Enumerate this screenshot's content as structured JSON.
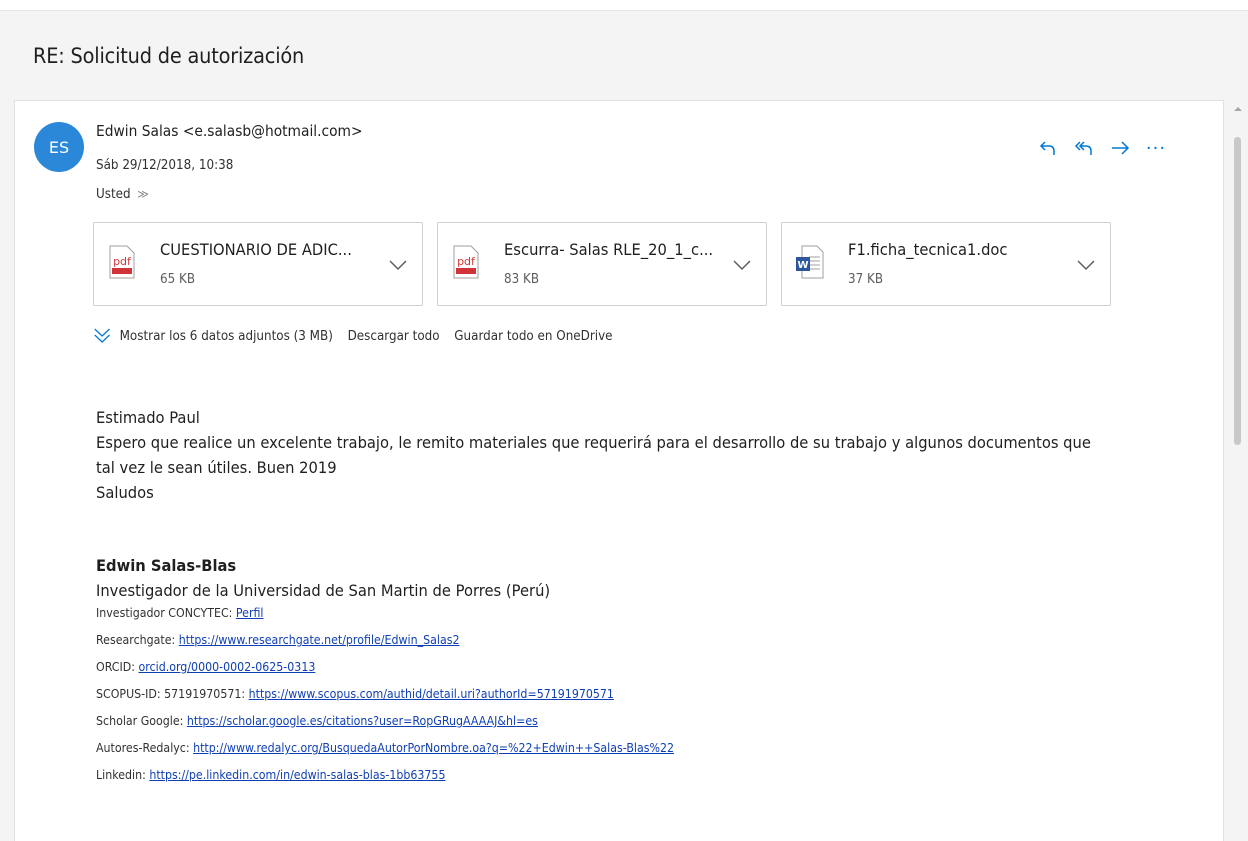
{
  "subject": "RE: Solicitud de autorización",
  "colors": {
    "accent": "#0078d4",
    "avatar_bg": "#2b88d8",
    "pdf_red": "#d13438",
    "word_blue": "#2b579a",
    "link": "#0f3fb4"
  },
  "message": {
    "avatar_initials": "ES",
    "sender": "Edwin Salas <e.salasb@hotmail.com>",
    "date": "Sáb 29/12/2018, 10:38",
    "recipient": "Usted",
    "recipient_chevron": "≫"
  },
  "actions": {
    "reply_icon": "reply-icon",
    "reply_all_icon": "reply-all-icon",
    "forward_icon": "forward-icon",
    "more": "···"
  },
  "attachments": [
    {
      "name": "CUESTIONARIO DE ADIC...",
      "size": "65 KB",
      "icon": "pdf-icon"
    },
    {
      "name": "Escurra- Salas RLE_20_1_c...",
      "size": "83 KB",
      "icon": "pdf-icon"
    },
    {
      "name": "F1.ficha_tecnica1.doc",
      "size": "37 KB",
      "icon": "word-icon"
    }
  ],
  "attachment_links": {
    "show_all": "Mostrar los 6 datos adjuntos (3 MB)",
    "download_all": "Descargar todo",
    "save_onedrive": "Guardar todo en OneDrive"
  },
  "body": {
    "greeting": "Estimado Paul",
    "line1": "Espero que realice un excelente trabajo, le remito materiales que requerirá para el desarrollo de su trabajo y algunos documentos que tal vez le sean útiles. Buen 2019",
    "closing": "Saludos"
  },
  "signature": {
    "name": "Edwin Salas-Blas",
    "title": "Investigador de la Universidad de San Martin de Porres (Perú)",
    "rows": [
      {
        "label": "Investigador CONCYTEC: ",
        "link": "Perfil"
      },
      {
        "label": "Researchgate: ",
        "link": "https://www.researchgate.net/profile/Edwin_Salas2"
      },
      {
        "label": "ORCID: ",
        "link": "orcid.org/0000-0002-0625-0313"
      },
      {
        "label": "SCOPUS-ID: 57191970571: ",
        "link": "https://www.scopus.com/authid/detail.uri?authorId=57191970571"
      },
      {
        "label": "Scholar Google: ",
        "link": "https://scholar.google.es/citations?user=RopGRugAAAAJ&hl=es"
      },
      {
        "label": "Autores-Redalyc: ",
        "link": "http://www.redalyc.org/BusquedaAutorPorNombre.oa?q=%22+Edwin++Salas-Blas%22"
      },
      {
        "label": "Linkedin: ",
        "link": "https://pe.linkedin.com/in/edwin-salas-blas-1bb63755"
      }
    ]
  }
}
